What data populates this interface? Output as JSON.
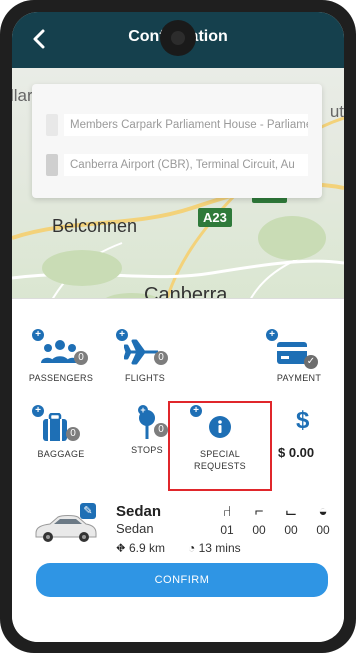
{
  "header": {
    "title": "Confirmation",
    "back_icon": "chevron-left-icon"
  },
  "map": {
    "labels": {
      "top_left": "llara",
      "top_right": "ut",
      "belconnen": "Belconnen",
      "canberra": "Canberra"
    },
    "road_badges": {
      "a23": "A23",
      "m23": "M23"
    },
    "pickup": "Members Carpark Parliament House - Parliament",
    "dropoff": "Canberra Airport (CBR), Terminal Circuit, Au"
  },
  "options": {
    "passengers": {
      "label": "PASSENGERS",
      "count": "0",
      "icon": "people-icon"
    },
    "flights": {
      "label": "FLIGHTS",
      "count": "0",
      "icon": "plane-icon"
    },
    "payment": {
      "label": "PAYMENT",
      "icon": "credit-card-icon"
    },
    "baggage": {
      "label": "BAGGAGE",
      "count": "0",
      "icon": "luggage-icon"
    },
    "stops": {
      "label": "STOPS",
      "count": "0",
      "icon": "map-pin-icon"
    },
    "special_requests": {
      "label_line1": "SPECIAL",
      "label_line2": "REQUESTS",
      "icon": "info-icon"
    },
    "price": {
      "symbol": "$",
      "value": "$ 0.00"
    }
  },
  "vehicle": {
    "title": "Sedan",
    "type": "Sedan",
    "distance": "6.9 km",
    "duration": "13 mins",
    "seats": [
      {
        "name": "adult-seat",
        "count": "01"
      },
      {
        "name": "booster-seat",
        "count": "00"
      },
      {
        "name": "child-seat",
        "count": "00"
      },
      {
        "name": "baby-capsule",
        "count": "00"
      }
    ]
  },
  "confirm_label": "CONFIRM",
  "colors": {
    "header": "#15404d",
    "accent": "#1e6fb5",
    "button": "#2f95e4",
    "highlight": "#e0262b"
  }
}
